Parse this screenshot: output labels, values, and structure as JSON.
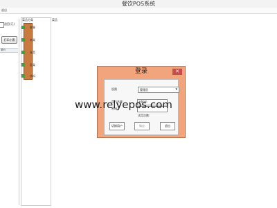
{
  "window": {
    "title": "餐饮POS系统"
  },
  "menubar": {
    "item": "退出"
  },
  "left_panel": {
    "back_label": "退回(元)",
    "print_label": "打印小票",
    "header": "单价"
  },
  "categories": {
    "label": "菜品分类",
    "items": [
      "套餐",
      "肉类",
      "青菜",
      "面类",
      "饮料"
    ]
  },
  "products": {
    "label": "菜品"
  },
  "watermark": "www.relyepos.com",
  "dialog": {
    "title": "登录",
    "role_label": "权限",
    "role_value": "管理员",
    "username_label": "用户名称",
    "username_value": "admin",
    "password_label": "密码",
    "password_value": "*",
    "attempts_label": "试用次数:",
    "attempts_value": "",
    "buttons": {
      "switch": "切换用户",
      "confirm": "确定",
      "exit": "退出"
    }
  },
  "colors": {
    "dialog_header": "#f2a57c",
    "close_button": "#c94c4c",
    "category_strip": "#c87a3f",
    "category_icon": "#36a63a"
  }
}
